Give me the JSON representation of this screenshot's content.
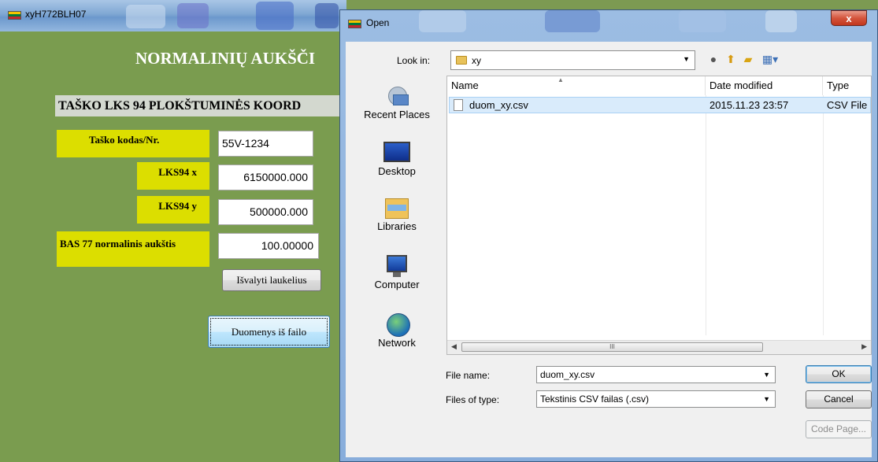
{
  "app": {
    "title": "xyH772BLH07",
    "heading": "NORMALINIŲ AUKŠČI",
    "coords_header": "TAŠKO LKS 94 PLOKŠTUMINĖS KOORD",
    "fields": {
      "point_code_label": "Taško kodas/Nr.",
      "point_code_value": "55V-1234",
      "x_label": "LKS94 x",
      "x_value": "6150000.000",
      "y_label": "LKS94 y",
      "y_value": "500000.000",
      "height_label": "BAS 77 normalinis aukštis",
      "height_value": "100.00000"
    },
    "clear_button": "Išvalyti laukelius",
    "file_button": "Duomenys iš failo"
  },
  "dialog": {
    "title": "Open",
    "close_label": "x",
    "look_in_label": "Look in:",
    "look_in_value": "xy",
    "places": [
      "Recent Places",
      "Desktop",
      "Libraries",
      "Computer",
      "Network"
    ],
    "columns": {
      "name": "Name",
      "date": "Date modified",
      "type": "Type"
    },
    "files": [
      {
        "name": "duom_xy.csv",
        "date": "2015.11.23 23:57",
        "type": "CSV File"
      }
    ],
    "scroll_thumb": "III",
    "file_name_label": "File name:",
    "file_name_value": "duom_xy.csv",
    "file_type_label": "Files of type:",
    "file_type_value": "Tekstinis CSV failas (.csv)",
    "ok_label": "OK",
    "cancel_label": "Cancel",
    "codepage_label": "Code Page..."
  },
  "colors": {
    "app_background": "#7a9c4f",
    "label_yellow": "#dcde00",
    "selection": "#d9ebfb"
  }
}
